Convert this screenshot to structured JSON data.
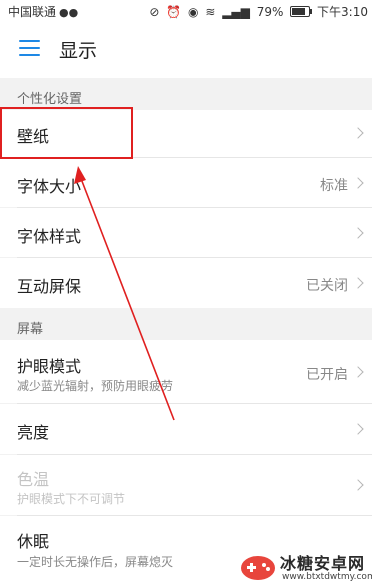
{
  "status_bar": {
    "carrier": "中国联通",
    "battery_percent": "79%",
    "battery_level": 0.79,
    "time": "下午3:10"
  },
  "app_bar": {
    "title": "显示"
  },
  "sections": {
    "personalization": {
      "header": "个性化设置",
      "wallpaper": "壁纸",
      "font_size": "字体大小",
      "font_size_value": "标准",
      "font_style": "字体样式",
      "screensaver": "互动屏保",
      "screensaver_value": "已关闭"
    },
    "screen": {
      "header": "屏幕",
      "eye_comfort": "护眼模式",
      "eye_comfort_sub": "减少蓝光辐射，预防用眼疲劳",
      "eye_comfort_value": "已开启",
      "brightness": "亮度",
      "color_temp": "色温",
      "color_temp_sub": "护眼模式下不可调节",
      "sleep": "休眠",
      "sleep_sub": "一定时长无操作后，屏幕熄灭"
    }
  },
  "watermark": {
    "name": "冰糖安卓网",
    "url": "www.btxtdwtmy.com"
  },
  "colors": {
    "accent": "#1e88e5",
    "annotation_red": "#e02020"
  }
}
